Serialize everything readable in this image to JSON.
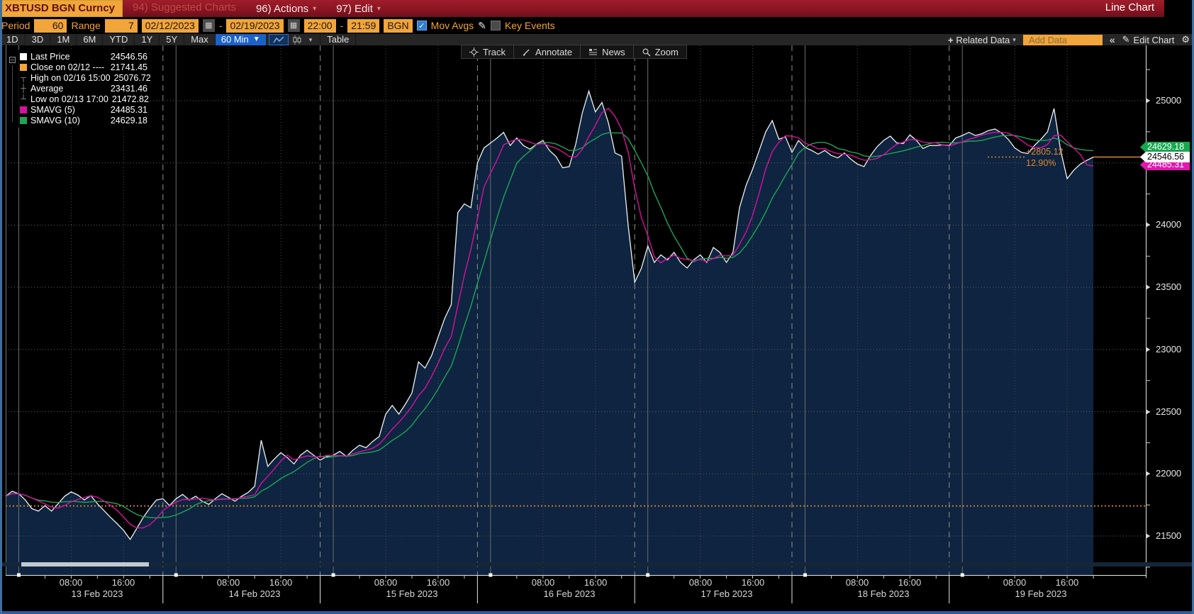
{
  "titlebar": {
    "ticker": "XBTUSD BGN Curncy",
    "suggested": "94) Suggested Charts",
    "actions": "96) Actions",
    "edit": "97) Edit",
    "view_label": "Line Chart"
  },
  "icons": {
    "caret": "▾",
    "caret_solid": "▼",
    "calendar": "▦",
    "check": "✓",
    "pencil": "✎",
    "collapse": "«",
    "gear": "⚙",
    "plus": "+",
    "expander_minus": "–"
  },
  "controls": {
    "period_label": "Period",
    "period_value": "60",
    "range_label": "Range",
    "range_value": "7",
    "date_from": "02/12/2023",
    "date_to": "02/19/2023",
    "sep": "-",
    "time_from": "22:00",
    "time_to": "21:59",
    "source": "BGN",
    "mov_avgs_label": "Mov Avgs",
    "mov_avgs_checked": true,
    "key_events_label": "Key Events",
    "key_events_checked": false
  },
  "toolbar": {
    "ranges": [
      "1D",
      "3D",
      "1M",
      "6M",
      "YTD",
      "1Y",
      "5Y",
      "Max"
    ],
    "interval": "60 Min",
    "table_label": "Table",
    "related_data": "Related Data",
    "add_data_placeholder": "Add Data",
    "edit_chart": "Edit Chart"
  },
  "chart_toolbar": [
    {
      "icon": "track-icon",
      "label": "Track"
    },
    {
      "icon": "annotate-icon",
      "label": "Annotate"
    },
    {
      "icon": "news-icon",
      "label": "News"
    },
    {
      "icon": "zoom-icon",
      "label": "Zoom"
    }
  ],
  "legend": {
    "rows": [
      {
        "swatch": "square",
        "color": "#ffffff",
        "label": "Last Price",
        "value": "24546.56"
      },
      {
        "swatch": "square",
        "color": "#f2a53a",
        "label": "Close on 02/12 ----",
        "value": "21741.45"
      },
      {
        "swatch": "glyph",
        "glyph": "┬",
        "label": "High on 02/16 15:00",
        "value": "25076.72"
      },
      {
        "swatch": "glyph",
        "glyph": "┼",
        "label": "Average",
        "value": "23431.46"
      },
      {
        "swatch": "glyph",
        "glyph": "┴",
        "label": "Low on 02/13 17:00",
        "value": "21472.82"
      },
      {
        "swatch": "square",
        "color": "#d6129e",
        "label": "SMAVG (5)",
        "value": "24485.31"
      },
      {
        "swatch": "square",
        "color": "#1ea556",
        "label": "SMAVG (10)",
        "value": "24629.18"
      }
    ]
  },
  "chart_data": {
    "type": "line",
    "title": "XBTUSD BGN Curncy 60-minute line chart",
    "x_start": "2023-02-12 22:00",
    "x_end": "2023-02-19 21:59",
    "interval_minutes": 60,
    "days": [
      "13 Feb 2023",
      "14 Feb 2023",
      "15 Feb 2023",
      "16 Feb 2023",
      "17 Feb 2023",
      "18 Feb 2023",
      "19 Feb 2023"
    ],
    "time_tick_labels": [
      "08:00",
      "16:00"
    ],
    "time_tick_hours": [
      8,
      16
    ],
    "y_axis": {
      "labels": [
        25000,
        24000,
        23500,
        23000,
        22500,
        22000,
        21500
      ],
      "gridlines": [
        25000,
        24500,
        24000,
        23500,
        23000,
        22500,
        22000,
        21500
      ],
      "minor_step": 250,
      "min": 21187,
      "max": 25445
    },
    "key_levels": {
      "last_price": 24546.56,
      "close_0212": 21741.45,
      "high": {
        "time": "02/16 15:00",
        "value": 25076.72
      },
      "average": 23431.46,
      "low": {
        "time": "02/13 17:00",
        "value": 21472.82
      },
      "smavg_5": 24485.31,
      "smavg_10": 24629.18
    },
    "annotation": {
      "change": "+2805.12",
      "change_pct": "12.90%",
      "color": "#dd8833"
    },
    "price_tags": [
      {
        "text": "24629.18",
        "price": 24629.18,
        "bg": "#15a94f",
        "fg": "#ffffff"
      },
      {
        "text": "24546.56",
        "price": 24546.56,
        "bg": "#ffffff",
        "fg": "#000000"
      },
      {
        "text": "24485.31",
        "price": 24485.31,
        "bg": "#e018ae",
        "fg": "#ffffff"
      }
    ],
    "series": [
      {
        "name": "Last Price",
        "color": "#eef2f5",
        "fill": "#0e2440",
        "values": [
          21820,
          21860,
          21840,
          21790,
          21720,
          21700,
          21745,
          21700,
          21760,
          21820,
          21855,
          21830,
          21790,
          21825,
          21760,
          21705,
          21650,
          21600,
          21545,
          21473,
          21560,
          21650,
          21725,
          21790,
          21800,
          21745,
          21800,
          21835,
          21790,
          21820,
          21780,
          21755,
          21800,
          21840,
          21810,
          21780,
          21820,
          21850,
          21900,
          22270,
          22060,
          22120,
          22170,
          22130,
          22080,
          22150,
          22190,
          22150,
          22110,
          22140,
          22150,
          22180,
          22140,
          22190,
          22230,
          22210,
          22260,
          22300,
          22480,
          22550,
          22480,
          22560,
          22650,
          22900,
          22850,
          22950,
          23100,
          23250,
          23360,
          24100,
          24170,
          24140,
          24500,
          24620,
          24660,
          24700,
          24745,
          24640,
          24700,
          24640,
          24610,
          24650,
          24680,
          24600,
          24550,
          24460,
          24470,
          24650,
          24900,
          25077,
          24910,
          24985,
          24820,
          24580,
          24554,
          24000,
          23540,
          23650,
          23832,
          23700,
          23760,
          23720,
          23780,
          23700,
          23655,
          23720,
          23760,
          23700,
          23820,
          23780,
          23700,
          23780,
          24140,
          24320,
          24450,
          24600,
          24750,
          24840,
          24690,
          24710,
          24585,
          24680,
          24625,
          24600,
          24570,
          24600,
          24560,
          24540,
          24580,
          24530,
          24490,
          24470,
          24560,
          24630,
          24680,
          24715,
          24660,
          24655,
          24725,
          24680,
          24615,
          24640,
          24640,
          24645,
          24640,
          24700,
          24720,
          24745,
          24720,
          24735,
          24760,
          24772,
          24740,
          24690,
          24620,
          24585,
          24575,
          24640,
          24690,
          24750,
          24937,
          24600,
          24373,
          24440,
          24490,
          24520,
          24547
        ]
      },
      {
        "name": "SMAVG (5)",
        "color": "#d6129e",
        "derived_period": 5
      },
      {
        "name": "SMAVG (10)",
        "color": "#1ea556",
        "derived_period": 10
      }
    ]
  }
}
